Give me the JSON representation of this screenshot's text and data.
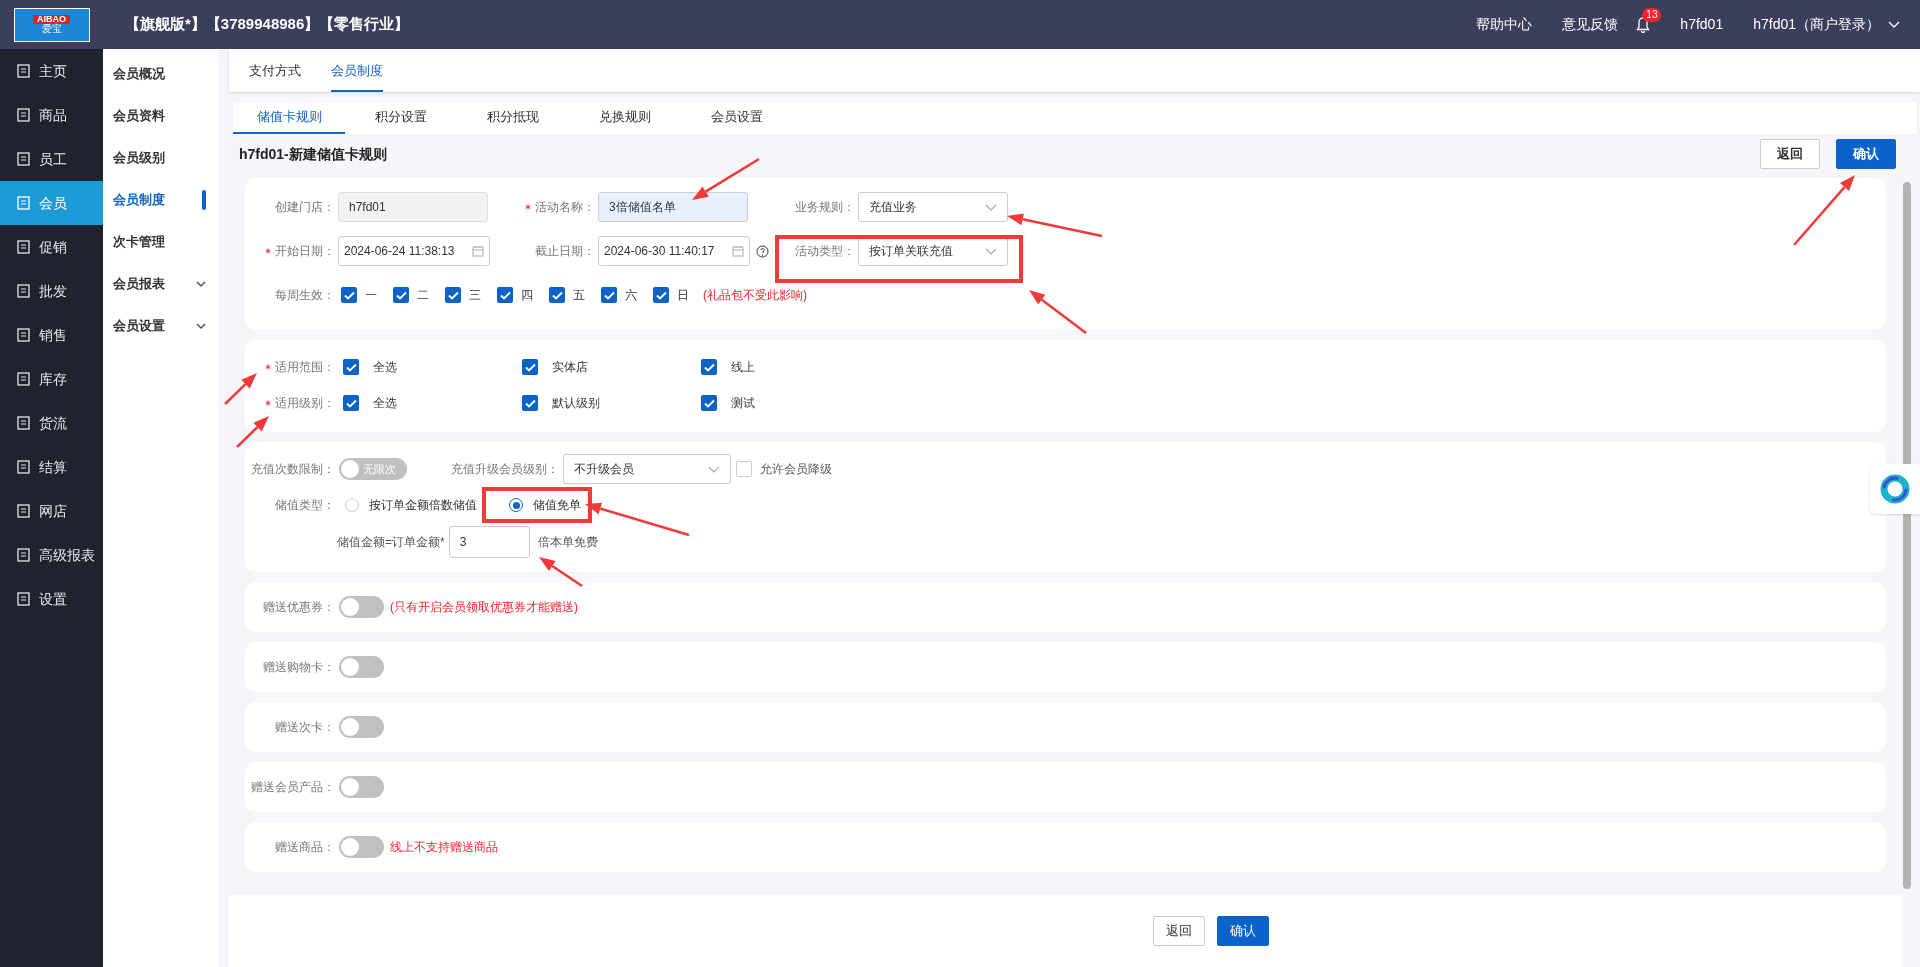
{
  "logo": {
    "text": "AIBAO",
    "subtext": "爱宝"
  },
  "header": {
    "title": "【旗舰版*】【3789948986】【零售行业】",
    "links": [
      "帮助中心",
      "意见反馈"
    ],
    "notification_count": "13",
    "user": "h7fd01",
    "account": "h7fd01（商户登录）"
  },
  "sidebar": {
    "items": [
      {
        "label": "主页",
        "selected": false
      },
      {
        "label": "商品",
        "selected": false
      },
      {
        "label": "员工",
        "selected": false
      },
      {
        "label": "会员",
        "selected": true
      },
      {
        "label": "促销",
        "selected": false
      },
      {
        "label": "批发",
        "selected": false
      },
      {
        "label": "销售",
        "selected": false
      },
      {
        "label": "库存",
        "selected": false
      },
      {
        "label": "货流",
        "selected": false
      },
      {
        "label": "结算",
        "selected": false
      },
      {
        "label": "网店",
        "selected": false
      },
      {
        "label": "高级报表",
        "selected": false
      },
      {
        "label": "设置",
        "selected": false
      }
    ]
  },
  "submenu": {
    "items": [
      {
        "label": "会员概况",
        "selected": false,
        "expandable": false
      },
      {
        "label": "会员资料",
        "selected": false,
        "expandable": false
      },
      {
        "label": "会员级别",
        "selected": false,
        "expandable": false
      },
      {
        "label": "会员制度",
        "selected": true,
        "expandable": false
      },
      {
        "label": "次卡管理",
        "selected": false,
        "expandable": false
      },
      {
        "label": "会员报表",
        "selected": false,
        "expandable": true
      },
      {
        "label": "会员设置",
        "selected": false,
        "expandable": true
      }
    ]
  },
  "top_tabs": [
    {
      "label": "支付方式",
      "selected": false
    },
    {
      "label": "会员制度",
      "selected": true
    }
  ],
  "sub_tabs": [
    {
      "label": "储值卡规则",
      "selected": true
    },
    {
      "label": "积分设置",
      "selected": false
    },
    {
      "label": "积分抵现",
      "selected": false
    },
    {
      "label": "兑换规则",
      "selected": false
    },
    {
      "label": "会员设置",
      "selected": false
    }
  ],
  "page_title": "h7fd01-新建储值卡规则",
  "header_actions": [
    {
      "label": "返回",
      "kind": "secondary"
    },
    {
      "label": "确认",
      "kind": "primary"
    }
  ],
  "basic_fields": [
    {
      "label": "创建门店：",
      "required": false,
      "kind": "readonly",
      "value": "h7fd01"
    },
    {
      "label": "活动名称：",
      "required": true,
      "kind": "highlight",
      "value": "3倍储值名单"
    },
    {
      "label": "业务规则：",
      "required": false,
      "kind": "select",
      "value": "充值业务"
    },
    {
      "label": "开始日期：",
      "required": true,
      "kind": "date",
      "value": "2024-06-24 11:38:13"
    },
    {
      "label": "截止日期：",
      "required": false,
      "kind": "date_help",
      "value": "2024-06-30 11:40:17"
    },
    {
      "label": "活动类型：",
      "required": false,
      "kind": "select",
      "value": "按订单关联充值"
    }
  ],
  "weekdays": {
    "label": "每周生效：",
    "days": [
      {
        "label": "一",
        "checked": true
      },
      {
        "label": "二",
        "checked": true
      },
      {
        "label": "三",
        "checked": true
      },
      {
        "label": "四",
        "checked": true
      },
      {
        "label": "五",
        "checked": true
      },
      {
        "label": "六",
        "checked": true
      },
      {
        "label": "日",
        "checked": true
      }
    ],
    "note": "(礼品包不受此影响)"
  },
  "scope_rows": [
    {
      "label": "适用范围：",
      "required": true,
      "options": [
        {
          "label": "全选",
          "checked": true
        },
        {
          "label": "实体店",
          "checked": true
        },
        {
          "label": "线上",
          "checked": true
        }
      ]
    },
    {
      "label": "适用级别：",
      "required": true,
      "options": [
        {
          "label": "全选",
          "checked": true
        },
        {
          "label": "默认级别",
          "checked": true
        },
        {
          "label": "测试",
          "checked": true
        }
      ]
    }
  ],
  "recharge": {
    "limit": {
      "label": "充值次数限制：",
      "on": false,
      "switch_text": "无限次"
    },
    "upgrade": {
      "label": "充值升级会员级别：",
      "value": "不升级会员"
    },
    "downgrade": {
      "label": "允许会员降级",
      "checked": false
    },
    "stored_type": {
      "label": "储值类型：",
      "options": [
        {
          "label": "按订单金额倍数储值",
          "selected": false
        },
        {
          "label": "储值免单",
          "selected": true
        }
      ]
    },
    "formula": {
      "label": "储值金额=订单金额*",
      "value": "3",
      "suffix": "倍本单免费"
    }
  },
  "gifts": [
    {
      "label": "赠送优惠券：",
      "on": false,
      "note": "(只有开启会员领取优惠券才能赠送)"
    },
    {
      "label": "赠送购物卡：",
      "on": false
    },
    {
      "label": "赠送次卡：",
      "on": false
    },
    {
      "label": "赠送会员产品：",
      "on": false
    },
    {
      "label": "赠送商品：",
      "on": false,
      "note": "线上不支持赠送商品"
    }
  ],
  "footer_actions": [
    {
      "label": "返回",
      "kind": "secondary"
    },
    {
      "label": "确认",
      "kind": "primary"
    }
  ]
}
